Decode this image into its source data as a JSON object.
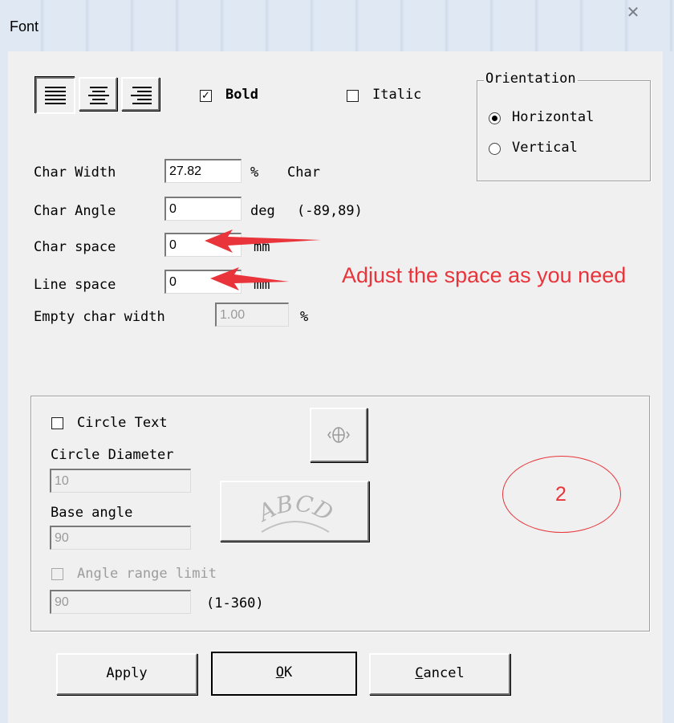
{
  "window": {
    "title": "Font",
    "close_glyph": "✕"
  },
  "alignment": {
    "options": [
      "left",
      "center",
      "right"
    ],
    "selected": "left"
  },
  "bold": {
    "label": "Bold",
    "checked": true,
    "mark": "✓"
  },
  "italic": {
    "label": "Italic",
    "checked": false
  },
  "orientation": {
    "legend": "Orientation",
    "options": [
      {
        "label": "Horizontal",
        "selected": true
      },
      {
        "label": "Vertical",
        "selected": false
      }
    ]
  },
  "fields": {
    "char_width": {
      "label": "Char Width",
      "value": "27.82",
      "unit": "%",
      "extra": "Char"
    },
    "char_angle": {
      "label": "Char Angle",
      "value": "0",
      "unit": "deg",
      "extra": "(-89,89)"
    },
    "char_space": {
      "label": "Char space",
      "value": "0",
      "unit": "mm"
    },
    "line_space": {
      "label": "Line space",
      "value": "0",
      "unit": "mm"
    },
    "empty_char_width": {
      "label": "Empty char width",
      "value": "1.00",
      "unit": "%"
    }
  },
  "annotation": {
    "text": "Adjust the space as you need",
    "circle_label": "2",
    "color": "#e8343a"
  },
  "circle_text": {
    "checkbox_label": "Circle Text",
    "diameter_label": "Circle Diameter",
    "diameter_value": "10",
    "base_angle_label": "Base angle",
    "base_angle_value": "90",
    "angle_limit_label": "Angle range limit",
    "angle_limit_value": "90",
    "angle_limit_range": "(1-360)",
    "preview_text": "ABCD",
    "small_icon": "globe-arrows-icon"
  },
  "buttons": {
    "apply": "Apply",
    "ok_first": "O",
    "ok_rest": "K",
    "cancel_first": "C",
    "cancel_rest": "ancel"
  }
}
